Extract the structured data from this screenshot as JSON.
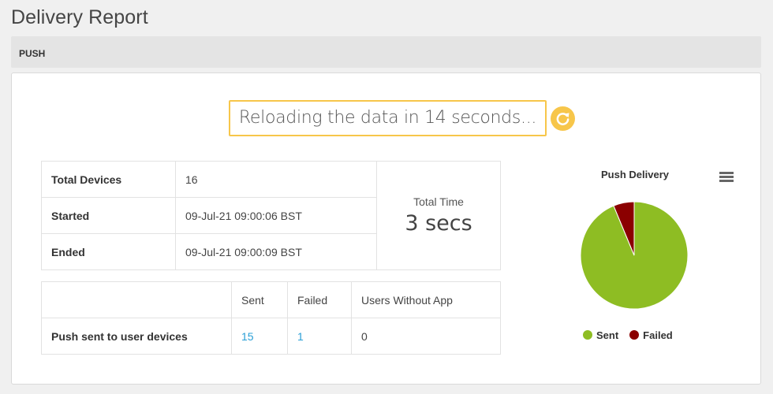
{
  "page_title": "Delivery Report",
  "section": "PUSH",
  "reload_text": "Reloading the data in 14 seconds...",
  "summary": {
    "total_devices_label": "Total Devices",
    "total_devices_value": "16",
    "started_label": "Started",
    "started_value": "09-Jul-21 09:00:06 BST",
    "ended_label": "Ended",
    "ended_value": "09-Jul-21 09:00:09 BST",
    "total_time_label": "Total Time",
    "total_time_value": "3 secs"
  },
  "stats": {
    "headers": [
      "",
      "Sent",
      "Failed",
      "Users Without App"
    ],
    "row_label": "Push sent to user devices",
    "sent": "15",
    "failed": "1",
    "without_app": "0"
  },
  "colors": {
    "accent": "#f7c64a",
    "sent": "#8ebd23",
    "failed": "#8b0000",
    "link": "#2a9fd6"
  },
  "chart_data": {
    "type": "pie",
    "title": "Push Delivery",
    "series": [
      {
        "name": "Sent",
        "value": 15,
        "color": "#8ebd23"
      },
      {
        "name": "Failed",
        "value": 1,
        "color": "#8b0000"
      }
    ],
    "legend": "bottom"
  }
}
